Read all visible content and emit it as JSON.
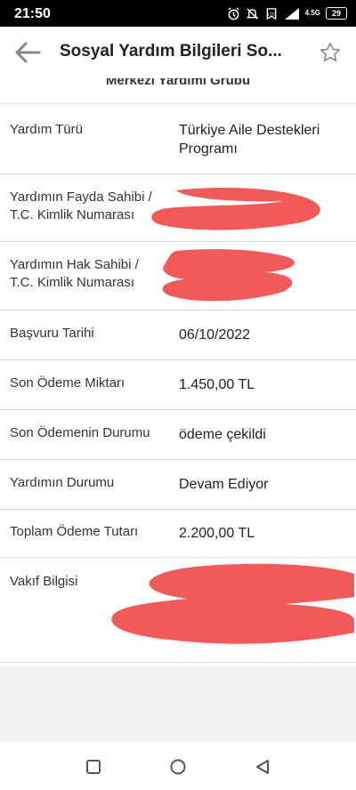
{
  "status_bar": {
    "time": "21:50",
    "network": "4.5G",
    "battery": "29",
    "icons": [
      "alarm-icon",
      "mute-icon",
      "volte-icon",
      "signal-icon",
      "battery-icon"
    ]
  },
  "header": {
    "title": "Sosyal Yardım Bilgileri So...",
    "back_icon": "arrow-left-icon",
    "favorite_icon": "star-outline-icon"
  },
  "group_title": "Merkezi Yardımı Grubu",
  "rows": [
    {
      "label": "Yardım Türü",
      "value": "Türkiye Aile Destekleri Programı"
    },
    {
      "label": "Yardımın Fayda Sahibi / T.C. Kimlik Numarası",
      "value": ""
    },
    {
      "label": "Yardımın Hak Sahibi / T.C. Kimlik Numarası",
      "value": ""
    },
    {
      "label": "Başvuru Tarihi",
      "value": "06/10/2022"
    },
    {
      "label": "Son Ödeme Miktarı",
      "value": "1.450,00 TL"
    },
    {
      "label": "Son Ödemenin Durumu",
      "value": "ödeme çekildi"
    },
    {
      "label": "Yardımın Durumu",
      "value": "Devam Ediyor"
    },
    {
      "label": "Toplam Ödeme Tutarı",
      "value": "2.200,00 TL"
    },
    {
      "label": "Vakıf Bilgisi",
      "value": ""
    }
  ],
  "colors": {
    "redaction": "#f25a5a",
    "accent": "#888888"
  },
  "nav": {
    "icons": [
      "recent-apps-icon",
      "home-icon",
      "back-triangle-icon"
    ]
  }
}
